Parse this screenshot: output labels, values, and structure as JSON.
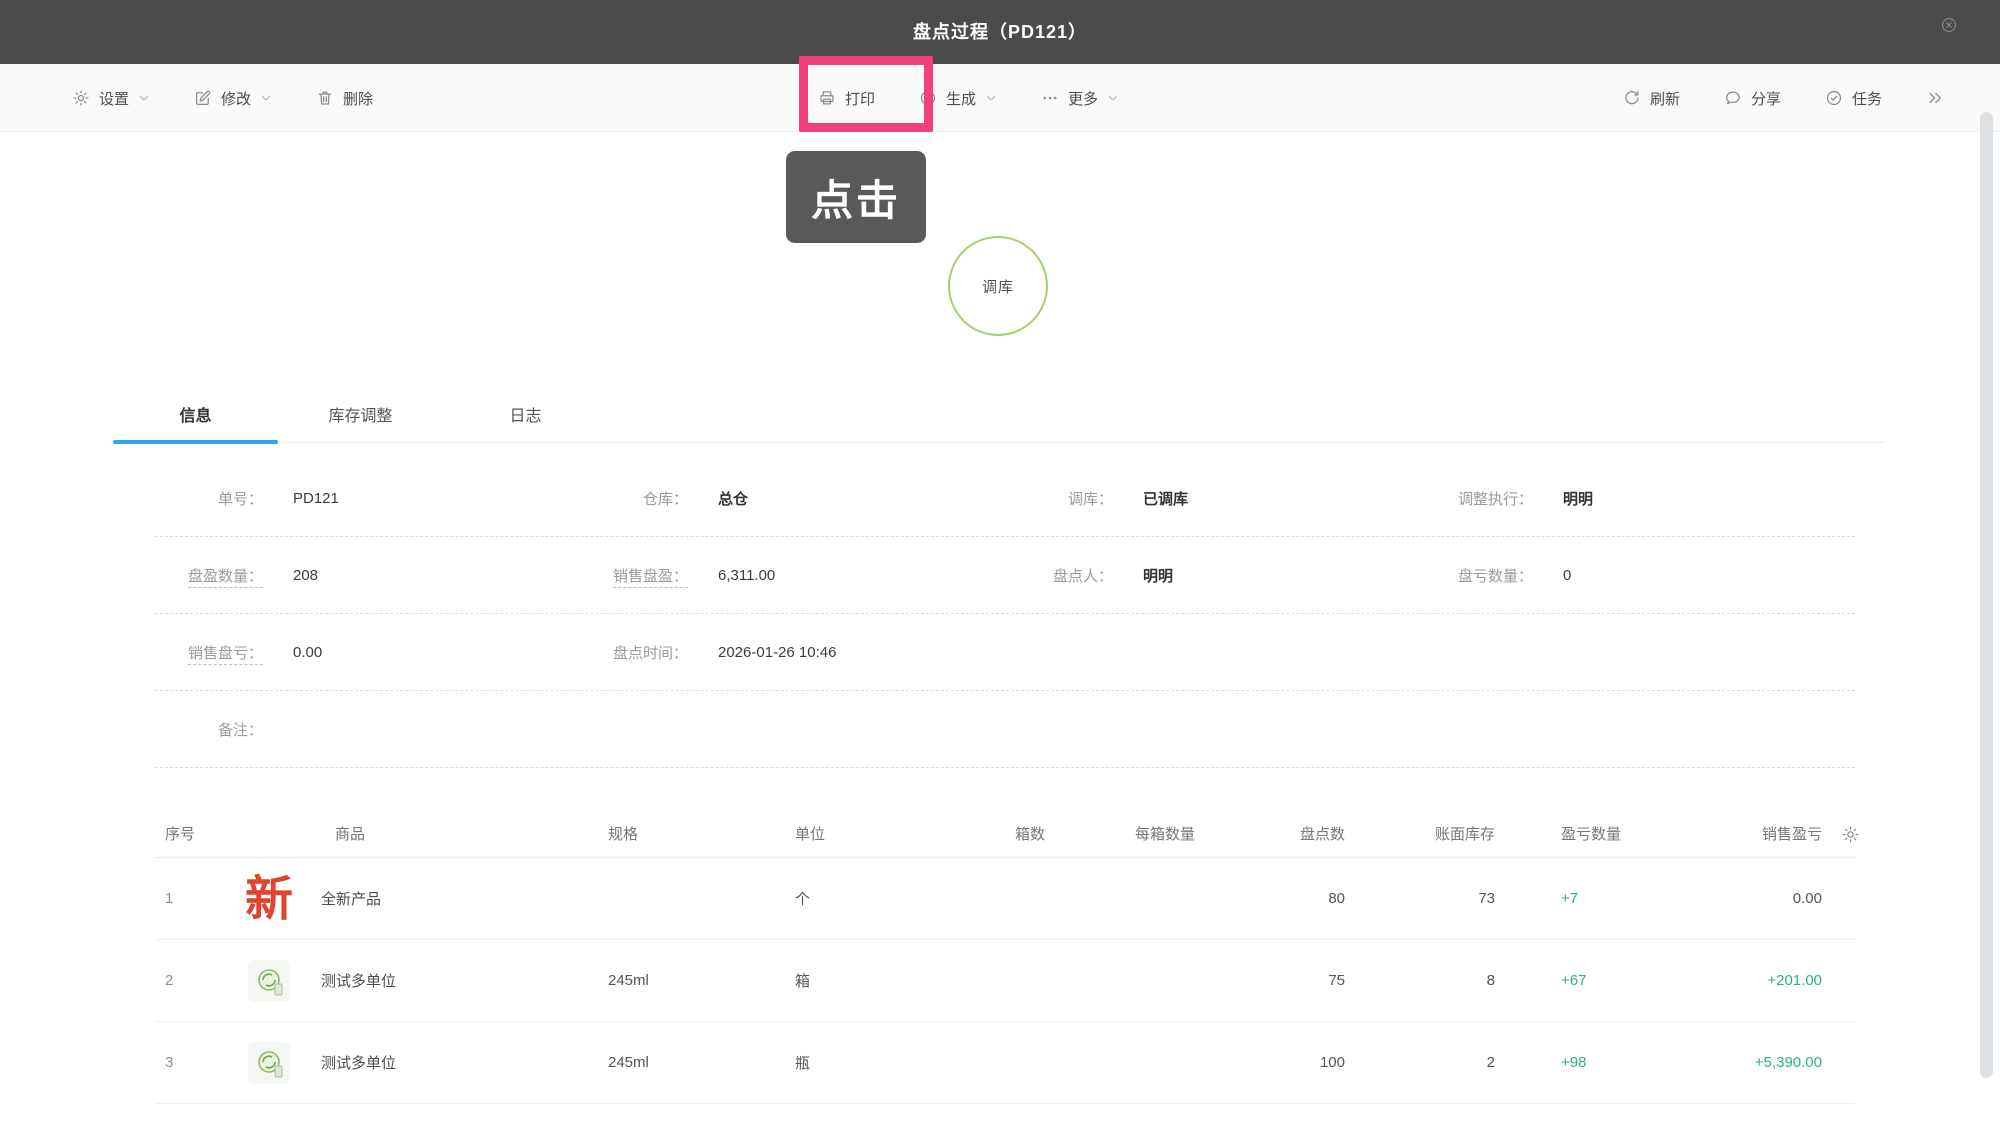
{
  "colors": {
    "header_bg": "#4b4b4b",
    "highlight_pink": "#f43f7f",
    "tab_active_blue": "#2ba6e9",
    "positive_green": "#2bb673",
    "new_badge_red": "#df4430",
    "badge_circle_green": "#a6cf6e"
  },
  "header": {
    "title": "盘点过程（PD121）"
  },
  "toolbar": {
    "left": [
      {
        "id": "settings",
        "icon": "gear-icon",
        "label": "设置",
        "chevron": true
      },
      {
        "id": "edit",
        "icon": "edit-icon",
        "label": "修改",
        "chevron": true
      },
      {
        "id": "delete",
        "icon": "trash-icon",
        "label": "删除",
        "chevron": false
      }
    ],
    "center": [
      {
        "id": "print",
        "icon": "printer-icon",
        "label": "打印",
        "chevron": false
      },
      {
        "id": "generate",
        "icon": "plus-circle-icon",
        "label": "生成",
        "chevron": true
      },
      {
        "id": "more",
        "icon": "ellipsis-icon",
        "label": "更多",
        "chevron": true
      }
    ],
    "right": [
      {
        "id": "refresh",
        "icon": "refresh-icon",
        "label": "刷新",
        "chevron": false
      },
      {
        "id": "share",
        "icon": "share-icon",
        "label": "分享",
        "chevron": false
      },
      {
        "id": "tasks",
        "icon": "check-circle-icon",
        "label": "任务",
        "chevron": false
      },
      {
        "id": "expand",
        "icon": "double-chevron-right-icon",
        "label": "",
        "chevron": false
      }
    ]
  },
  "annotation": {
    "tooltip_label": "点击"
  },
  "status_badge": {
    "label": "调库"
  },
  "tabs": [
    {
      "id": "info",
      "label": "信息",
      "active": true
    },
    {
      "id": "stock-adjust",
      "label": "库存调整",
      "active": false
    },
    {
      "id": "log",
      "label": "日志",
      "active": false
    }
  ],
  "info_fields": [
    [
      {
        "label": "单号：",
        "value": "PD121"
      },
      {
        "label": "仓库：",
        "value": "总仓",
        "strong": true
      },
      {
        "label": "调库：",
        "value": "已调库",
        "strong": true
      },
      {
        "label": "调整执行：",
        "value": "明明",
        "strong": true
      }
    ],
    [
      {
        "label": "盘盈数量：",
        "value": "208",
        "hint": true
      },
      {
        "label": "销售盘盈：",
        "value": "6,311.00",
        "hint": true
      },
      {
        "label": "盘点人：",
        "value": "明明",
        "strong": true
      },
      {
        "label": "盘亏数量：",
        "value": "0"
      }
    ],
    [
      {
        "label": "销售盘亏：",
        "value": "0.00",
        "hint": true
      },
      {
        "label": "盘点时间：",
        "value": "2026-01-26 10:46"
      }
    ],
    [
      {
        "label": "备注：",
        "value": ""
      }
    ]
  ],
  "table": {
    "columns": [
      {
        "key": "seq",
        "label": "序号"
      },
      {
        "key": "product",
        "label": "商品"
      },
      {
        "key": "spec",
        "label": "规格"
      },
      {
        "key": "unit",
        "label": "单位"
      },
      {
        "key": "boxes",
        "label": "箱数"
      },
      {
        "key": "per_box",
        "label": "每箱数量"
      },
      {
        "key": "counted",
        "label": "盘点数"
      },
      {
        "key": "book",
        "label": "账面库存"
      },
      {
        "key": "diff",
        "label": "盈亏数量"
      },
      {
        "key": "sales",
        "label": "销售盈亏"
      }
    ],
    "rows": [
      {
        "seq": "1",
        "badge": "new-char",
        "badge_char": "新",
        "product": "全新产品",
        "spec": "",
        "unit": "个",
        "boxes": "",
        "per_box": "",
        "counted": "80",
        "book": "73",
        "diff": "+7",
        "sales": "0.00"
      },
      {
        "seq": "2",
        "badge": "thumb",
        "badge_char": "",
        "product": "测试多单位",
        "spec": "245ml",
        "unit": "箱",
        "boxes": "",
        "per_box": "",
        "counted": "75",
        "book": "8",
        "diff": "+67",
        "sales": "+201.00"
      },
      {
        "seq": "3",
        "badge": "thumb",
        "badge_char": "",
        "product": "测试多单位",
        "spec": "245ml",
        "unit": "瓶",
        "boxes": "",
        "per_box": "",
        "counted": "100",
        "book": "2",
        "diff": "+98",
        "sales": "+5,390.00"
      }
    ]
  }
}
